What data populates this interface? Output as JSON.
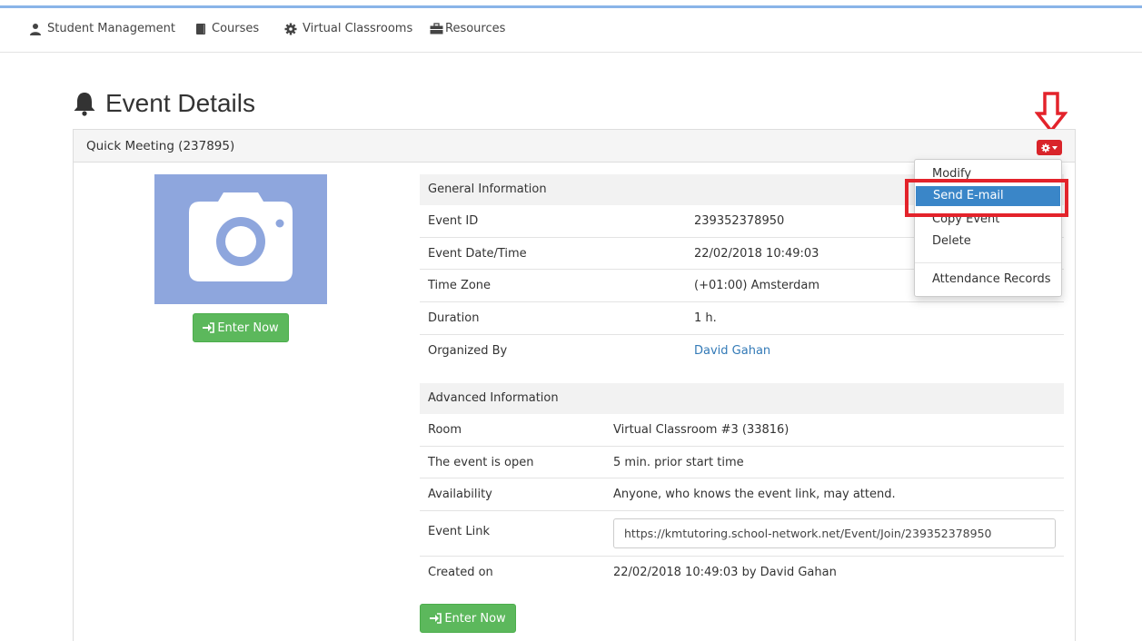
{
  "nav": {
    "items": [
      {
        "label": "Student Management",
        "icon": "user-icon"
      },
      {
        "label": "Courses",
        "icon": "book-icon"
      },
      {
        "label": "Virtual Classrooms",
        "icon": "gear-icon"
      },
      {
        "label": "Resources",
        "icon": "briefcase-icon"
      }
    ]
  },
  "page": {
    "title": "Event Details",
    "title_icon": "bell-icon"
  },
  "panel": {
    "title": "Quick Meeting (237895)",
    "enter_label": "Enter Now"
  },
  "dropdown": {
    "items": [
      "Modify",
      "Send E-mail",
      "Copy Event",
      "Delete",
      "Attendance Records"
    ],
    "active": "Send E-mail"
  },
  "general": {
    "heading": "General Information",
    "rows": [
      {
        "label": "Event ID",
        "value": "239352378950"
      },
      {
        "label": "Event Date/Time",
        "value": "22/02/2018 10:49:03"
      },
      {
        "label": "Time Zone",
        "value": "(+01:00) Amsterdam"
      },
      {
        "label": "Duration",
        "value": "1 h."
      },
      {
        "label": "Organized By",
        "value": "David Gahan"
      }
    ]
  },
  "advanced": {
    "heading": "Advanced Information",
    "rows": [
      {
        "label": "Room",
        "value": "Virtual Classroom #3 (33816)"
      },
      {
        "label": "The event is open",
        "value": "5 min. prior start time"
      },
      {
        "label": "Availability",
        "value": "Anyone, who knows the event link, may attend."
      },
      {
        "label": "Event Link",
        "value": "https://kmtutoring.school-network.net/Event/Join/239352378950"
      },
      {
        "label": "Created on",
        "value": "22/02/2018 10:49:03 by David Gahan"
      }
    ]
  },
  "colors": {
    "accent_red": "#d9242a",
    "enter_green": "#5cb85c",
    "link_blue": "#337ab7",
    "photo_blue": "#8ea6dd"
  }
}
